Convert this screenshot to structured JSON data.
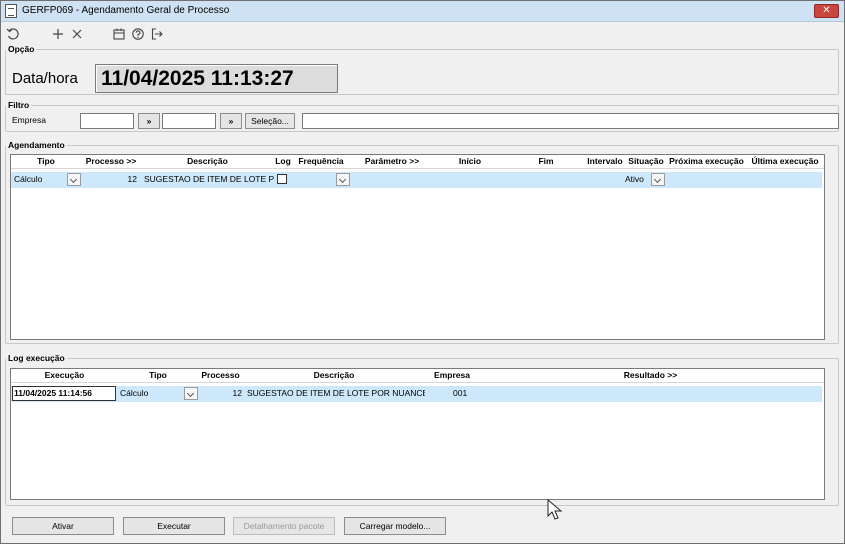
{
  "window": {
    "title": "GERFP069 - Agendamento Geral de Processo",
    "close_label": "✕"
  },
  "toolbar": {
    "icons": [
      "refresh-icon",
      "add-icon",
      "delete-icon",
      "calendar-icon",
      "help-icon",
      "exit-icon"
    ]
  },
  "opcao": {
    "legend": "Opção",
    "label": "Data/hora",
    "value": "11/04/2025 11:13:27"
  },
  "filtro": {
    "legend": "Filtro",
    "empresa_label": "Empresa",
    "empresa_from": "",
    "empresa_to": "",
    "jump_label": "»",
    "selecao_label": "Seleção...",
    "selecao_value": ""
  },
  "agendamento": {
    "legend": "Agendamento",
    "columns": [
      "Tipo",
      "Processo >>",
      "Descrição",
      "Log",
      "Frequência",
      "Parâmetro >>",
      "Início",
      "Fim",
      "Intervalo",
      "Situação",
      "Próxima execução",
      "Última execução"
    ],
    "rows": [
      {
        "tipo": "Cálculo",
        "processo": "12",
        "descricao": "SUGESTAO DE ITEM DE LOTE POR NUANCE",
        "log": false,
        "frequencia": "",
        "parametro": "",
        "inicio": "",
        "fim": "",
        "intervalo": "",
        "situacao": "Ativo",
        "proxima": "",
        "ultima": ""
      }
    ]
  },
  "log_execucao": {
    "legend": "Log execução",
    "columns": [
      "Execução",
      "Tipo",
      "Processo",
      "Descrição",
      "Empresa",
      "Resultado >>"
    ],
    "rows": [
      {
        "execucao": "11/04/2025 11:14:56",
        "tipo": "Cálculo",
        "processo": "12",
        "descricao": "SUGESTAO DE ITEM DE LOTE POR NUANCE",
        "empresa": "001",
        "resultado": ""
      }
    ]
  },
  "footer": {
    "ativar": "Ativar",
    "executar": "Executar",
    "detalhamento": "Detalhamento pacote",
    "carregar": "Carregar modelo..."
  }
}
